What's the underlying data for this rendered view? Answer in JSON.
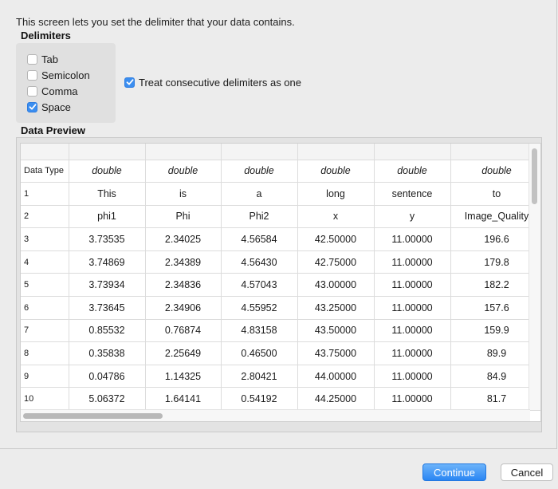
{
  "description": "This screen lets you set the delimiter that your data contains.",
  "delimiters": {
    "heading": "Delimiters",
    "options": [
      {
        "label": "Tab",
        "checked": false
      },
      {
        "label": "Semicolon",
        "checked": false
      },
      {
        "label": "Comma",
        "checked": false
      },
      {
        "label": "Space",
        "checked": true
      }
    ],
    "consecutive": {
      "label": "Treat consecutive delimiters as one",
      "checked": true
    }
  },
  "preview": {
    "heading": "Data Preview",
    "type_row_label": "Data Type",
    "column_types": [
      "double",
      "double",
      "double",
      "double",
      "double",
      "double"
    ],
    "rows": [
      {
        "num": "1",
        "cells": [
          "This",
          "is",
          "a",
          "long",
          "sentence",
          "to"
        ]
      },
      {
        "num": "2",
        "cells": [
          "phi1",
          "Phi",
          "Phi2",
          "x",
          "y",
          "Image_Quality"
        ]
      },
      {
        "num": "3",
        "cells": [
          "3.73535",
          "2.34025",
          "4.56584",
          "42.50000",
          "11.00000",
          "196.6"
        ]
      },
      {
        "num": "4",
        "cells": [
          "3.74869",
          "2.34389",
          "4.56430",
          "42.75000",
          "11.00000",
          "179.8"
        ]
      },
      {
        "num": "5",
        "cells": [
          "3.73934",
          "2.34836",
          "4.57043",
          "43.00000",
          "11.00000",
          "182.2"
        ]
      },
      {
        "num": "6",
        "cells": [
          "3.73645",
          "2.34906",
          "4.55952",
          "43.25000",
          "11.00000",
          "157.6"
        ]
      },
      {
        "num": "7",
        "cells": [
          "0.85532",
          "0.76874",
          "4.83158",
          "43.50000",
          "11.00000",
          "159.9"
        ]
      },
      {
        "num": "8",
        "cells": [
          "0.35838",
          "2.25649",
          "0.46500",
          "43.75000",
          "11.00000",
          "89.9"
        ]
      },
      {
        "num": "9",
        "cells": [
          "0.04786",
          "1.14325",
          "2.80421",
          "44.00000",
          "11.00000",
          "84.9"
        ]
      },
      {
        "num": "10",
        "cells": [
          "5.06372",
          "1.64141",
          "0.54192",
          "44.25000",
          "11.00000",
          "81.7"
        ]
      }
    ]
  },
  "buttons": {
    "continue": "Continue",
    "cancel": "Cancel"
  },
  "colors": {
    "accent": "#3b8ef0"
  }
}
